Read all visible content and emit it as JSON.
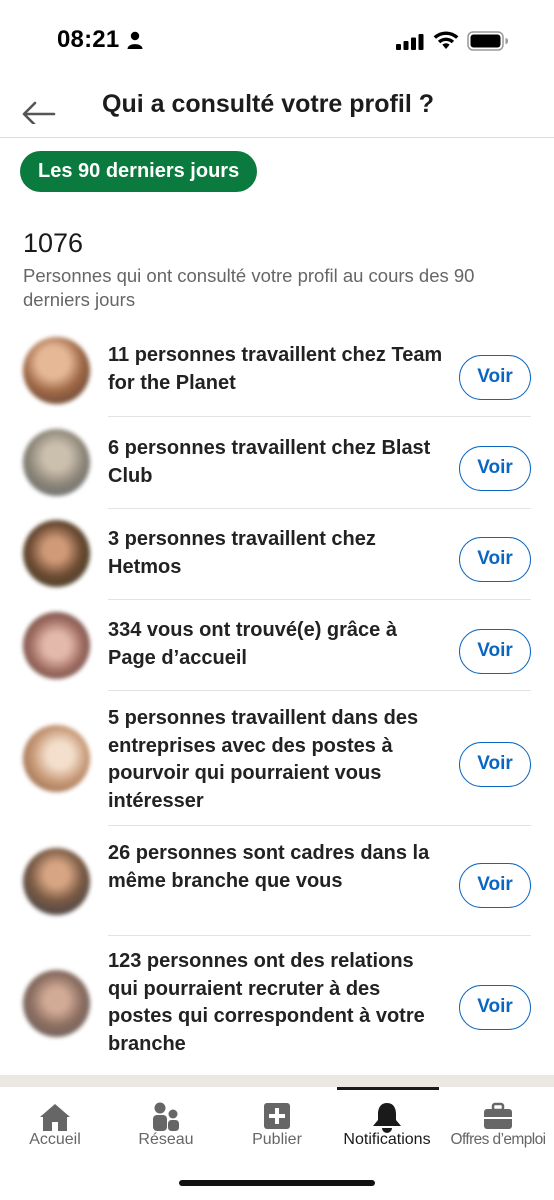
{
  "status_bar": {
    "time": "08:21"
  },
  "header": {
    "title": "Qui a consulté votre profil ?"
  },
  "filter": {
    "label": "Les 90 derniers jours"
  },
  "summary": {
    "count": "1076",
    "description": "Personnes qui ont consulté votre profil au cours des 90 derniers jours"
  },
  "viewers": [
    {
      "text": "11 personnes travaillent chez Team for the Planet",
      "button": "Voir"
    },
    {
      "text": "6 personnes travaillent chez Blast Club",
      "button": "Voir"
    },
    {
      "text": "3 personnes travaillent chez Hetmos",
      "button": "Voir"
    },
    {
      "text": "334 vous ont trouvé(e) grâce à Page d’accueil",
      "button": "Voir"
    },
    {
      "text": "5 personnes travaillent dans des entreprises avec des postes à pourvoir qui pourraient vous intéresser",
      "button": "Voir"
    },
    {
      "text": "26 personnes sont cadres dans la même branche que vous",
      "button": "Voir"
    },
    {
      "text": "123 personnes ont des relations qui pourraient recruter à des postes qui correspondent à votre branche",
      "button": "Voir"
    }
  ],
  "tabs": [
    {
      "label": "Accueil",
      "icon": "home-icon"
    },
    {
      "label": "Réseau",
      "icon": "network-icon"
    },
    {
      "label": "Publier",
      "icon": "post-icon"
    },
    {
      "label": "Notifications",
      "icon": "bell-icon",
      "active": true
    },
    {
      "label": "Offres d’emploi",
      "icon": "briefcase-icon"
    }
  ],
  "colors": {
    "filter_pill": "#0b7a3e",
    "link_blue": "#0a66c2",
    "divider": "#e2e2e2"
  }
}
